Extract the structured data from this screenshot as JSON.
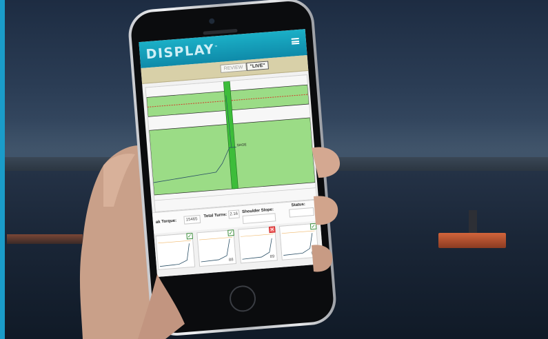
{
  "app": {
    "logo": "DISPLAY",
    "trademark": "™",
    "accent_color": "#1aa8c4"
  },
  "header": {
    "menu_icon": "hamburger-icon"
  },
  "modes": {
    "review_label": "REVIEW",
    "live_label": "LIVE"
  },
  "graph": {
    "annotation": "SHOE",
    "band_color": "#9bdc86",
    "marker_color": "#d33a2a"
  },
  "stats": {
    "peak_torque_label": "ak Torque:",
    "peak_torque_value": "15465",
    "total_turns_label": "Total Turns:",
    "total_turns_value": "2.16",
    "shoulder_slope_label": "Shoulder Slope:",
    "status_label": "Status:"
  },
  "thumbnails": [
    {
      "status": "pass",
      "number": ""
    },
    {
      "status": "pass",
      "number": "88"
    },
    {
      "status": "fail",
      "number": "89"
    },
    {
      "status": "pass",
      "number": "90"
    }
  ]
}
